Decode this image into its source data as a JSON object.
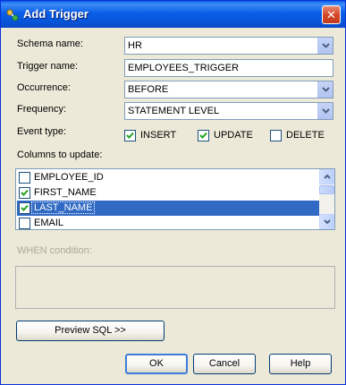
{
  "window": {
    "title": "Add Trigger",
    "close_glyph": "✕"
  },
  "form": {
    "schema": {
      "label": "Schema name:",
      "value": "HR"
    },
    "trigger_name": {
      "label": "Trigger name:",
      "value": "EMPLOYEES_TRIGGER"
    },
    "occurrence": {
      "label": "Occurrence:",
      "value": "BEFORE"
    },
    "frequency": {
      "label": "Frequency:",
      "value": "STATEMENT LEVEL"
    },
    "event_type": {
      "label": "Event type:",
      "options": [
        {
          "label": "INSERT",
          "checked": true
        },
        {
          "label": "UPDATE",
          "checked": true
        },
        {
          "label": "DELETE",
          "checked": false
        }
      ]
    },
    "columns": {
      "label": "Columns to update:",
      "items": [
        {
          "label": "EMPLOYEE_ID",
          "checked": false,
          "selected": false
        },
        {
          "label": "FIRST_NAME",
          "checked": true,
          "selected": false
        },
        {
          "label": "LAST_NAME",
          "checked": true,
          "selected": true
        },
        {
          "label": "EMAIL",
          "checked": false,
          "selected": false
        }
      ]
    },
    "when_condition": {
      "label": "WHEN condition:",
      "value": ""
    }
  },
  "buttons": {
    "preview": "Preview SQL >>",
    "ok": "OK",
    "cancel": "Cancel",
    "help": "Help"
  },
  "icons": {
    "title": "trigger-icon",
    "dropdown": "chevron-down-icon",
    "check": "checkmark-icon",
    "scroll_up": "arrow-up-icon",
    "scroll_down": "arrow-down-icon"
  },
  "colors": {
    "title_bar": "#0a5ee8",
    "selection": "#316ac5",
    "check": "#21a121",
    "close": "#d6482a"
  }
}
